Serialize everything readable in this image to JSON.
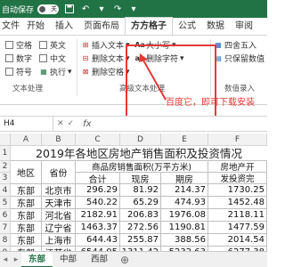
{
  "titlebar": {
    "autosave_label": "自动保存",
    "toggle_state": "关"
  },
  "tabs": [
    "文件",
    "开始",
    "插入",
    "页面布局",
    "方方格子",
    "公式",
    "数据",
    "审阅"
  ],
  "ribbon": {
    "checkboxes": [
      "空格",
      "英文",
      "数字",
      "中文",
      "符号"
    ],
    "exec_label": "执行",
    "group1_label": "文本处理",
    "btn_insert_text": "插入文本",
    "btn_delete_text": "删除文本",
    "btn_delete_space": "删除空格",
    "btn_case": "大小写",
    "btn_delete_format": "删除字符",
    "group2_label": "高级文本处理",
    "btn_round": "四舍五入",
    "btn_keep_value": "只保留数值",
    "group3_label": "数值录入"
  },
  "annotation": "百度它，即可下载安装",
  "formula_bar": {
    "name_box": "H4",
    "fx": "fx",
    "value": ""
  },
  "columns": [
    "A",
    "B",
    "C",
    "D",
    "E",
    "F"
  ],
  "rows": [
    "1",
    "2",
    "3",
    "4",
    "5",
    "6",
    "7",
    "8",
    "9",
    "10"
  ],
  "table": {
    "title": "2019年各地区房地产销售面积及投资情况",
    "header": {
      "region": "地区",
      "province": "省份",
      "group": "商品房销售面积(万平方米)",
      "sub": [
        "合计",
        "现房",
        "期房"
      ],
      "invest_1": "房地产开",
      "invest_2": "发投资完"
    },
    "data": [
      [
        "东部",
        "北京市",
        "296.29",
        "81.92",
        "214.37",
        "1730.25"
      ],
      [
        "东部",
        "天津市",
        "540.22",
        "65.29",
        "474.93",
        "1452.48"
      ],
      [
        "东部",
        "河北省",
        "2182.91",
        "206.83",
        "1976.08",
        "2118.11"
      ],
      [
        "东部",
        "辽宁省",
        "1463.37",
        "272.56",
        "1190.81",
        "1477.59"
      ],
      [
        "东部",
        "上海市",
        "644.43",
        "255.87",
        "388.56",
        "2014.54"
      ],
      [
        "东部",
        "江苏省",
        "6544.05",
        "1311.42",
        "5232.63",
        "6277.38"
      ],
      [
        "东部",
        "浙江省",
        "4547.35",
        "400.27",
        "4147.08",
        "5308.84"
      ]
    ]
  },
  "sheets": [
    "东部",
    "中部",
    "西部"
  ]
}
